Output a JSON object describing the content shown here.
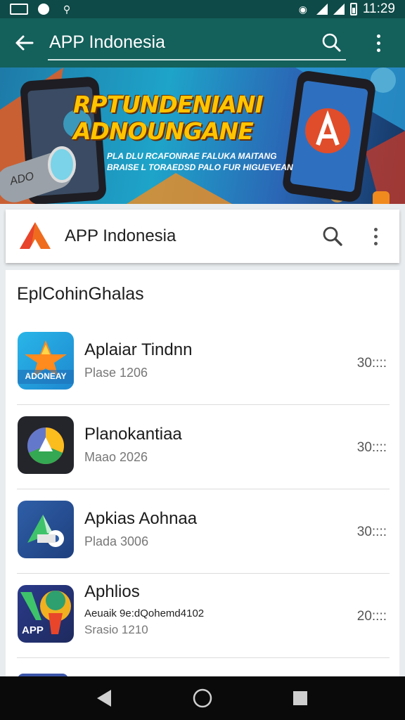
{
  "status_bar": {
    "time": "11:29"
  },
  "app_bar": {
    "search_value": "APP Indonesia"
  },
  "banner": {
    "headline_line1": "RPTUNDENIANI",
    "headline_line2": "ADNOUNGANE",
    "subtext_line1": "PLA DLU RCAFONRAE FALUKA MAITANG",
    "subtext_line2": "BRAISE L TORAEDSD PALO FUR HIGUEVEAN",
    "device_label": "ADO"
  },
  "card": {
    "title": "APP Indonesia"
  },
  "section": {
    "title": "EplCohinGhalas"
  },
  "apps": [
    {
      "name": "Aplaiar Tindnn",
      "subtitle": "Plase 1206",
      "meta": "30::::",
      "icon_text": "ADONEAY"
    },
    {
      "name": "Planokantiaa",
      "subtitle": "Maao 2026",
      "meta": "30::::",
      "icon_text": ""
    },
    {
      "name": "Apkias Aohnaa",
      "subtitle": "Plada 3006",
      "meta": "30::::",
      "icon_text": ""
    },
    {
      "name": "Aphlios",
      "subtitle": "Aeuaik 9e:dQohemd4102",
      "subtitle2": "Srasio 1210",
      "meta": "20::::",
      "icon_text": "APP"
    }
  ],
  "colors": {
    "status_bar": "#0e4a47",
    "app_bar": "#14605b",
    "nav_bar": "#0a0a0a",
    "banner_headline": "#ffc400"
  }
}
